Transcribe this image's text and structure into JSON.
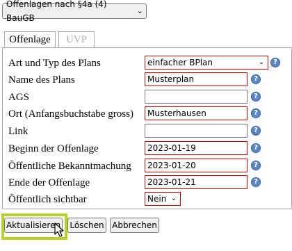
{
  "top_select": {
    "value": "Offenlagen nach §4a (4) BauGB"
  },
  "tabs": [
    {
      "label": "Offenlage",
      "active": true
    },
    {
      "label": "UVP",
      "active": false
    }
  ],
  "form": {
    "art": {
      "label": "Art und Typ des Plans",
      "value": "einfacher BPlan"
    },
    "name": {
      "label": "Name des Plans",
      "value": "Musterplan"
    },
    "ags": {
      "label": "AGS",
      "value": ""
    },
    "ort": {
      "label": "Ort (Anfangsbuchstabe gross)",
      "value": "Musterhausen"
    },
    "link": {
      "label": "Link",
      "value": ""
    },
    "beginn": {
      "label": "Beginn der Offenlage",
      "value": "2023-01-19"
    },
    "bekannt": {
      "label": "Öffentliche Bekanntmachung",
      "value": "2023-01-20"
    },
    "ende": {
      "label": "Ende der Offenlage",
      "value": "2023-01-21"
    },
    "sichtbar": {
      "label": "Öffentlich sichtbar",
      "value": "Nein"
    }
  },
  "buttons": {
    "update": "Aktualisieren",
    "delete": "Löschen",
    "cancel": "Abbrechen"
  },
  "help_glyph": "?",
  "colors": {
    "error_border": "#cc0000",
    "highlight": "#b5d42a",
    "help_icon": "#5b86c5"
  }
}
